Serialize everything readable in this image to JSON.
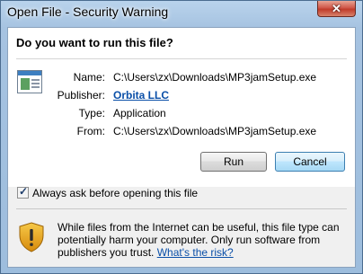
{
  "window": {
    "title": "Open File - Security Warning",
    "close_glyph": "✕"
  },
  "question": "Do you want to run this file?",
  "details": {
    "name_label": "Name:",
    "name_value": "C:\\Users\\zx\\Downloads\\MP3jamSetup.exe",
    "publisher_label": "Publisher:",
    "publisher_value": "Orbita LLC",
    "type_label": "Type:",
    "type_value": "Application",
    "from_label": "From:",
    "from_value": "C:\\Users\\zx\\Downloads\\MP3jamSetup.exe"
  },
  "buttons": {
    "run": "Run",
    "cancel": "Cancel"
  },
  "checkbox": {
    "label": "Always ask before opening this file",
    "checked": true,
    "check_glyph": "✓"
  },
  "warning": {
    "text": "While files from the Internet can be useful, this file type can potentially harm your computer. Only run software from publishers you trust.",
    "link": "What's the risk?",
    "icon": "shield-warning-icon"
  },
  "colors": {
    "link": "#0a4fa8",
    "titlebar": "#a6c3e1",
    "close": "#c13b2a"
  }
}
